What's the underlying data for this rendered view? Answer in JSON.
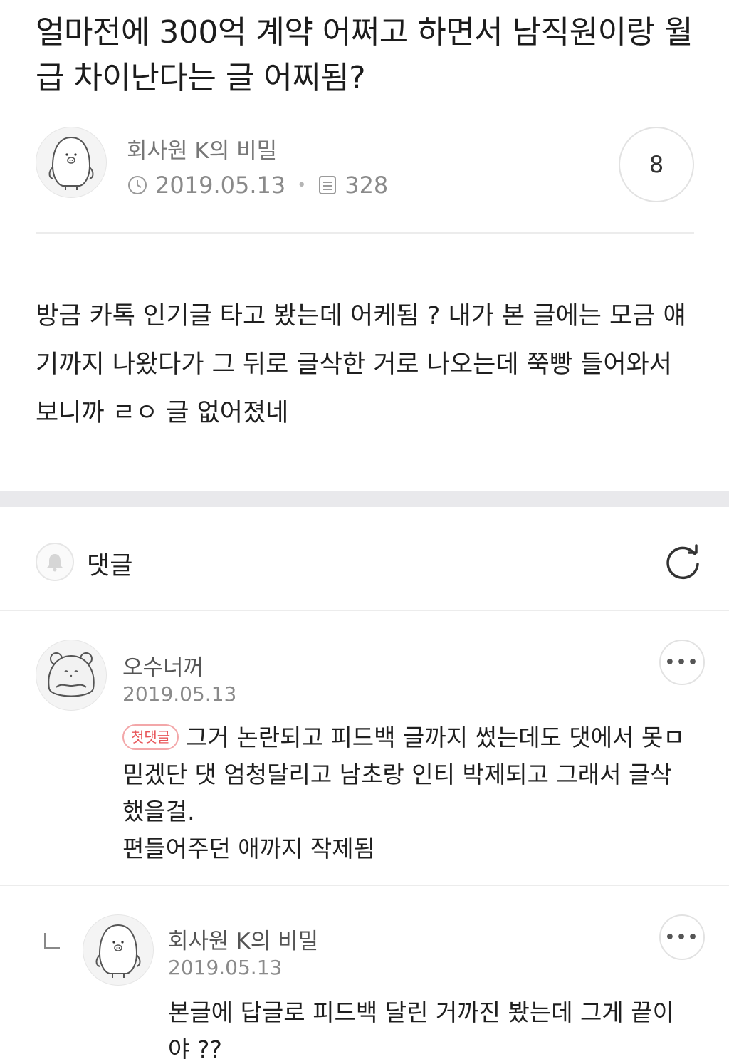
{
  "post": {
    "title": "얼마전에 300억 계약 어쩌고 하면서 남직원이랑 월급 차이난다는 글 어찌됨?",
    "author": "회사원 K의 비밀",
    "date": "2019.05.13",
    "views": "328",
    "comment_count": "8",
    "body": "방금 카톡 인기글 타고 봤는데 어케됨 ? 내가 본 글에는 모금 얘기까지 나왔다가 그 뒤로 글삭한 거로 나오는데 쭉빵 들어와서 보니까 ㄹㅇ 글 없어졌네"
  },
  "comments_section": {
    "label": "댓글"
  },
  "comments": [
    {
      "author": "오수너꺼",
      "date": "2019.05.13",
      "badge": "첫댓글",
      "text": "그거 논란되고 피드백 글까지 썼는데도 댓에서 못ㅁ믿겠단 댓 엄청달리고 남초랑 인티 박제되고 그래서 글삭했을걸.\n편들어주던 애까지 작제됨"
    },
    {
      "author": "회사원 K의 비밀",
      "date": "2019.05.13",
      "text": "본글에 답글로 피드백 달린 거까진 봤는데 그게 끝이야 ??"
    }
  ],
  "icons": {
    "clock": "clock-icon",
    "views": "document-icon",
    "bell": "bell-icon",
    "refresh": "refresh-icon",
    "more": "more-dots-icon",
    "reply": "reply-corner-icon"
  },
  "colors": {
    "badge": "#e8565a",
    "section_gap": "#e9e9ec"
  }
}
